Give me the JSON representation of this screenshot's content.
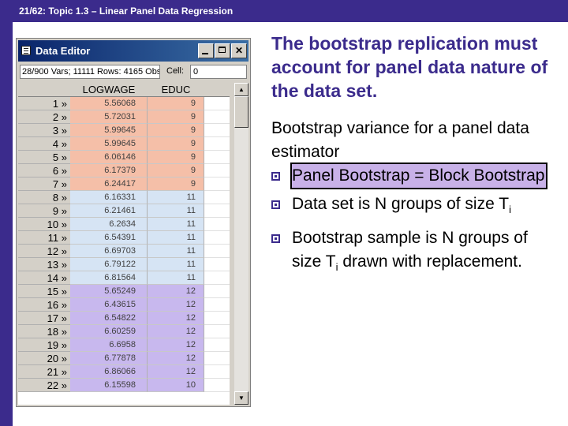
{
  "header": {
    "topic": "21/62: Topic 1.3 – Linear Panel Data Regression"
  },
  "window": {
    "title": "Data Editor",
    "info": "28/900 Vars; 11111 Rows: 4165 Obs",
    "cell_label": "Cell:",
    "cell_value": "0",
    "columns": [
      "LOGWAGE",
      "EDUC"
    ],
    "row_marker": "»",
    "rows": [
      {
        "n": "1",
        "logwage": "5.56068",
        "educ": "9"
      },
      {
        "n": "2",
        "logwage": "5.72031",
        "educ": "9"
      },
      {
        "n": "3",
        "logwage": "5.99645",
        "educ": "9"
      },
      {
        "n": "4",
        "logwage": "5.99645",
        "educ": "9"
      },
      {
        "n": "5",
        "logwage": "6.06146",
        "educ": "9"
      },
      {
        "n": "6",
        "logwage": "6.17379",
        "educ": "9"
      },
      {
        "n": "7",
        "logwage": "6.24417",
        "educ": "9"
      },
      {
        "n": "8",
        "logwage": "6.16331",
        "educ": "11"
      },
      {
        "n": "9",
        "logwage": "6.21461",
        "educ": "11"
      },
      {
        "n": "10",
        "logwage": "6.2634",
        "educ": "11"
      },
      {
        "n": "11",
        "logwage": "6.54391",
        "educ": "11"
      },
      {
        "n": "12",
        "logwage": "6.69703",
        "educ": "11"
      },
      {
        "n": "13",
        "logwage": "6.79122",
        "educ": "11"
      },
      {
        "n": "14",
        "logwage": "6.81564",
        "educ": "11"
      },
      {
        "n": "15",
        "logwage": "5.65249",
        "educ": "12"
      },
      {
        "n": "16",
        "logwage": "6.43615",
        "educ": "12"
      },
      {
        "n": "17",
        "logwage": "6.54822",
        "educ": "12"
      },
      {
        "n": "18",
        "logwage": "6.60259",
        "educ": "12"
      },
      {
        "n": "19",
        "logwage": "6.6958",
        "educ": "12"
      },
      {
        "n": "20",
        "logwage": "6.77878",
        "educ": "12"
      },
      {
        "n": "21",
        "logwage": "6.86066",
        "educ": "12"
      },
      {
        "n": "22",
        "logwage": "6.15598",
        "educ": "10"
      }
    ],
    "group_colors": [
      "#f5bfa8",
      "#d6e4f4",
      "#c8b8ee"
    ]
  },
  "slide": {
    "title": "The bootstrap replication must account for panel data nature of the data set.",
    "intro": "Bootstrap variance for a panel data estimator",
    "bullets": [
      {
        "text": "Panel Bootstrap = Block Bootstrap"
      },
      {
        "text": "Data set is N groups of size T",
        "sub": "i"
      },
      {
        "text_before": "Bootstrap sample is N groups of size T",
        "sub": "i",
        "text_after": " drawn with replacement."
      }
    ]
  },
  "colors": {
    "accent": "#3b2b8c",
    "highlight": "#c8b1e8"
  }
}
